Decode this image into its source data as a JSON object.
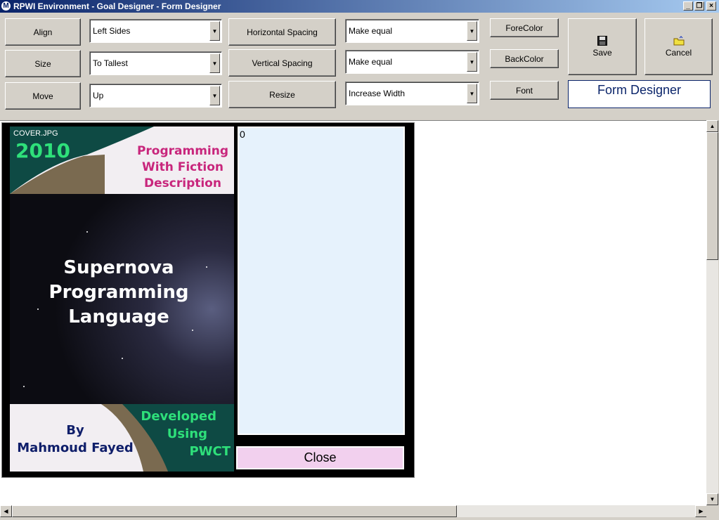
{
  "window": {
    "title": "RPWI Environment - Goal Designer - Form Designer",
    "app_icon": "M"
  },
  "toolbar": {
    "align_label": "Align",
    "size_label": "Size",
    "move_label": "Move",
    "align_value": "Left Sides",
    "size_value": "To Tallest",
    "move_value": "Up",
    "hspacing_label": "Horizontal Spacing",
    "vspacing_label": "Vertical Spacing",
    "resize_label": "Resize",
    "hspacing_value": "Make equal",
    "vspacing_value": "Make equal",
    "resize_value": "Increase Width",
    "forecolor_label": "ForeColor",
    "backcolor_label": "BackColor",
    "font_label": "Font",
    "save_label": "Save",
    "cancel_label": "Cancel",
    "form_name": "Form Designer"
  },
  "designed_form": {
    "image_caption": "COVER.JPG",
    "cover_year": "2010",
    "cover_subtitle": [
      "Programming",
      "With Fiction",
      "Description"
    ],
    "cover_title": [
      "Supernova",
      "Programming",
      "Language"
    ],
    "cover_author_by": "By",
    "cover_author": "Mahmoud Fayed",
    "cover_developed": [
      "Developed",
      "Using",
      "PWCT"
    ],
    "textbox_value": "0",
    "close_label": "Close"
  },
  "colors": {
    "textbox_bg": "#e6f2fc",
    "close_bg": "#f2d0ee",
    "teal": "#0e4a44",
    "green_text": "#2ee07a",
    "magenta_text": "#c8267c",
    "navy_text": "#0f1e6a"
  }
}
